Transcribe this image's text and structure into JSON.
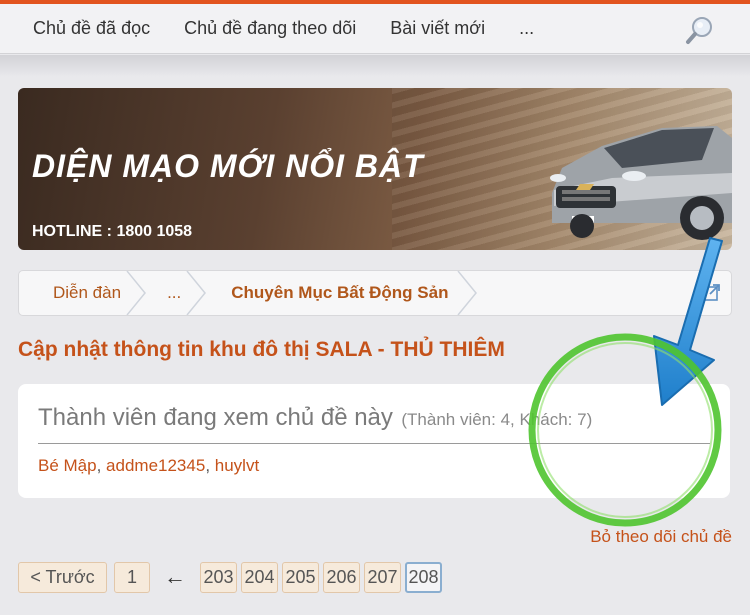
{
  "nav": {
    "items": [
      "Chủ đề đã đọc",
      "Chủ đề đang theo dõi",
      "Bài viết mới",
      "..."
    ],
    "search_icon": "search-icon"
  },
  "banner": {
    "title": "DIỆN MẠO MỚI NỔI BẬT",
    "hotline": "HOTLINE : 1800 1058"
  },
  "breadcrumb": {
    "items": [
      "Diễn đàn",
      "...",
      "Chuyên Mục Bất Động Sản"
    ]
  },
  "thread": {
    "title": "Cập nhật thông tin khu đô thị SALA - THỦ THIÊM"
  },
  "viewers": {
    "title": "Thành viên đang xem chủ đề này",
    "count": "(Thành viên: 4, Khách: 7)",
    "users": [
      "Bé Mập",
      "addme12345",
      "huylvt"
    ],
    "separator": ", "
  },
  "actions": {
    "unfollow": "Bỏ theo dõi chủ đề"
  },
  "pagination": {
    "prev": "< Trước",
    "first": "1",
    "arrow": "←",
    "pages": [
      "203",
      "204",
      "205",
      "206",
      "207",
      "208"
    ],
    "current": "208"
  },
  "colors": {
    "accent": "#c5521a",
    "topline": "#e2541f",
    "annotation_circle": "#4fc42f",
    "annotation_arrow": "#2f8fd6"
  }
}
